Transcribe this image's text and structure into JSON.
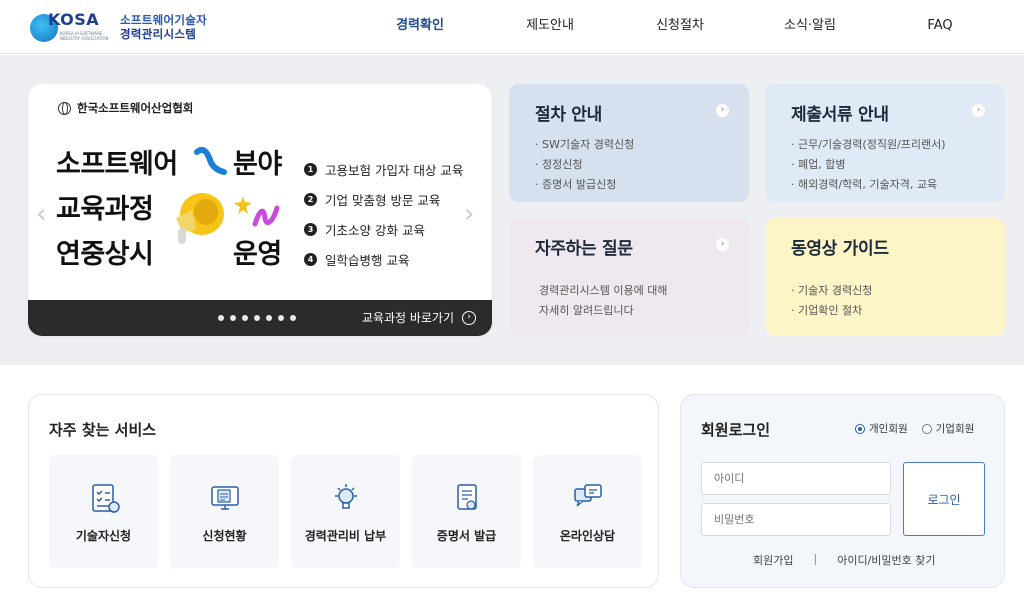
{
  "header": {
    "logo_text": "KOSA",
    "logo_sub": "KOREA AI SOFTWARE INDUSTRY ASSOCIATION",
    "logo_title_1": "소프트웨어기술자",
    "logo_title_2": "경력관리시스템",
    "nav": [
      "경력확인",
      "제도안내",
      "신청절차",
      "소식·알림",
      "FAQ"
    ],
    "nav_active": "경력확인"
  },
  "banner": {
    "org": "한국소프트웨어산업협회",
    "headline_1_left": "소프트웨어",
    "headline_1_right": "분야",
    "headline_2": "교육과정",
    "headline_3_left": "연중상시",
    "headline_3_right": "운영",
    "items": [
      "고용보험 가입자 대상 교육",
      "기업 맞춤형 방문 교육",
      "기초소양 강화 교육",
      "일학습병행 교육"
    ],
    "item_numbers": [
      "1",
      "2",
      "3",
      "4"
    ],
    "link": "교육과정 바로가기",
    "prev": "‹",
    "next": "›",
    "slide_count": 7
  },
  "cards": {
    "procedure": {
      "title": "절차 안내",
      "items": [
        "· SW기술자 경력신청",
        "· 정정신청",
        "· 증명서 발급신청"
      ]
    },
    "documents": {
      "title": "제출서류 안내",
      "items": [
        "· 근무/기술경력(정직원/프리랜서)",
        "· 폐업, 합병",
        "· 해외경력/학력, 기술자격, 교육"
      ]
    },
    "faq": {
      "title": "자주하는 질문",
      "text_1": "경력관리시스템 이용에 대해",
      "text_2": "자세히 알려드립니다"
    },
    "video": {
      "title": "동영상 가이드",
      "items": [
        "· 기술자 경력신청",
        "· 기업확인 절차"
      ]
    },
    "go_icon": "›"
  },
  "services": {
    "title": "자주 찾는 서비스",
    "tiles": [
      {
        "label": "기술자신청",
        "icon": "checklist-icon"
      },
      {
        "label": "신청현황",
        "icon": "monitor-document-icon"
      },
      {
        "label": "경력관리비 납부",
        "icon": "lightbulb-icon"
      },
      {
        "label": "증명서 발급",
        "icon": "certificate-icon"
      },
      {
        "label": "온라인상담",
        "icon": "chat-bubbles-icon"
      }
    ]
  },
  "login": {
    "title": "회원로그인",
    "radio_personal": "개인회원",
    "radio_corporate": "기업회원",
    "selected": "개인회원",
    "id_placeholder": "아이디",
    "pw_placeholder": "비밀번호",
    "button": "로그인",
    "signup": "회원가입",
    "separator": "|",
    "find": "아이디/비밀번호 찾기"
  },
  "colors": {
    "brand": "#1e3f8e",
    "nav_active": "#1d4d8f",
    "card_procedure": "#d6e0ee",
    "card_documents": "#dfeaf6",
    "card_faq": "#efe9ef",
    "card_video": "#fdf4c7",
    "banner_bar": "#2b2b2b"
  }
}
